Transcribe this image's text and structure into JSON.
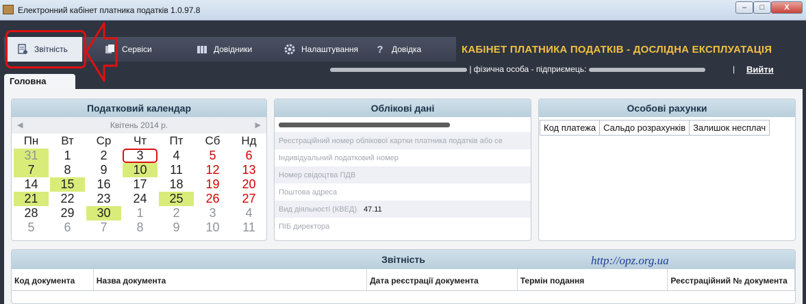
{
  "window": {
    "title": "Електронний кабінет платника податків 1.0.97.8",
    "buttons": [
      "–",
      "□",
      "X"
    ]
  },
  "navbar": [
    {
      "label": "Звітність",
      "icon": "reports-icon"
    },
    {
      "label": "Сервіси",
      "icon": "services-icon"
    },
    {
      "label": "Довідники",
      "icon": "directories-icon"
    },
    {
      "label": "Налаштування",
      "icon": "gear-icon"
    },
    {
      "label": "Довідка",
      "icon": "help-icon"
    }
  ],
  "header": {
    "cabinet_title": "КАБІНЕТ ПЛАТНИКА ПОДАТКІВ - ДОСЛІДНА ЕКСПЛУАТАЦІЯ",
    "user_type": "| фізична особа - підприємець:",
    "separator": "|",
    "logout": "Вийти"
  },
  "tabs": {
    "home": "Головна"
  },
  "calendar": {
    "title": "Податковий календар",
    "month": "Квітень 2014 р.",
    "days_of_week": [
      "Пн",
      "Вт",
      "Ср",
      "Чт",
      "Пт",
      "Сб",
      "Нд"
    ],
    "weeks": [
      [
        {
          "d": "31",
          "o": 1,
          "h": 1
        },
        {
          "d": "1"
        },
        {
          "d": "2"
        },
        {
          "d": "3",
          "t": 1
        },
        {
          "d": "4"
        },
        {
          "d": "5",
          "w": 1
        },
        {
          "d": "6",
          "w": 1
        }
      ],
      [
        {
          "d": "7",
          "h": 1
        },
        {
          "d": "8"
        },
        {
          "d": "9"
        },
        {
          "d": "10",
          "h": 1
        },
        {
          "d": "11"
        },
        {
          "d": "12",
          "w": 1
        },
        {
          "d": "13",
          "w": 1
        }
      ],
      [
        {
          "d": "14"
        },
        {
          "d": "15",
          "h": 1
        },
        {
          "d": "16"
        },
        {
          "d": "17"
        },
        {
          "d": "18"
        },
        {
          "d": "19",
          "w": 1
        },
        {
          "d": "20",
          "w": 1
        }
      ],
      [
        {
          "d": "21",
          "h": 1
        },
        {
          "d": "22"
        },
        {
          "d": "23"
        },
        {
          "d": "24"
        },
        {
          "d": "25",
          "h": 1
        },
        {
          "d": "26",
          "w": 1
        },
        {
          "d": "27",
          "w": 1
        }
      ],
      [
        {
          "d": "28"
        },
        {
          "d": "29"
        },
        {
          "d": "30",
          "h": 1
        },
        {
          "d": "1",
          "o": 1
        },
        {
          "d": "2",
          "o": 1
        },
        {
          "d": "3",
          "o": 1
        },
        {
          "d": "4",
          "o": 1
        }
      ],
      [
        {
          "d": "5",
          "o": 1
        },
        {
          "d": "6",
          "o": 1
        },
        {
          "d": "7",
          "o": 1
        },
        {
          "d": "8",
          "o": 1
        },
        {
          "d": "9",
          "o": 1
        },
        {
          "d": "10",
          "o": 1
        },
        {
          "d": "11",
          "o": 1
        }
      ]
    ],
    "highlight_color": "#d9ec7a",
    "weekend_color": "#d40000"
  },
  "account": {
    "title": "Облікові дані",
    "rows": [
      {
        "label": "Реєстраційний номер облікової картки платника податків або се",
        "value": ""
      },
      {
        "label": "Індивідуальний податковий номер",
        "value": ""
      },
      {
        "label": "Номер свідоцтва ПДВ",
        "value": ""
      },
      {
        "label": "Поштова адреса",
        "value": ""
      },
      {
        "label": "Вид діяльності (КВЕД)",
        "value": "47.11"
      },
      {
        "label": "ПІБ директора",
        "value": ""
      }
    ]
  },
  "personal": {
    "title": "Особові рахунки",
    "columns": [
      "Код платежа",
      "Сальдо розрахунків",
      "Залишок несплач"
    ]
  },
  "reports": {
    "title": "Звітність",
    "site": "http://opz.org.ua",
    "columns": [
      "Код документа",
      "Назва документа",
      "Дата реєстрації документа",
      "Термін подання",
      "Реєстраційний № документа"
    ]
  }
}
